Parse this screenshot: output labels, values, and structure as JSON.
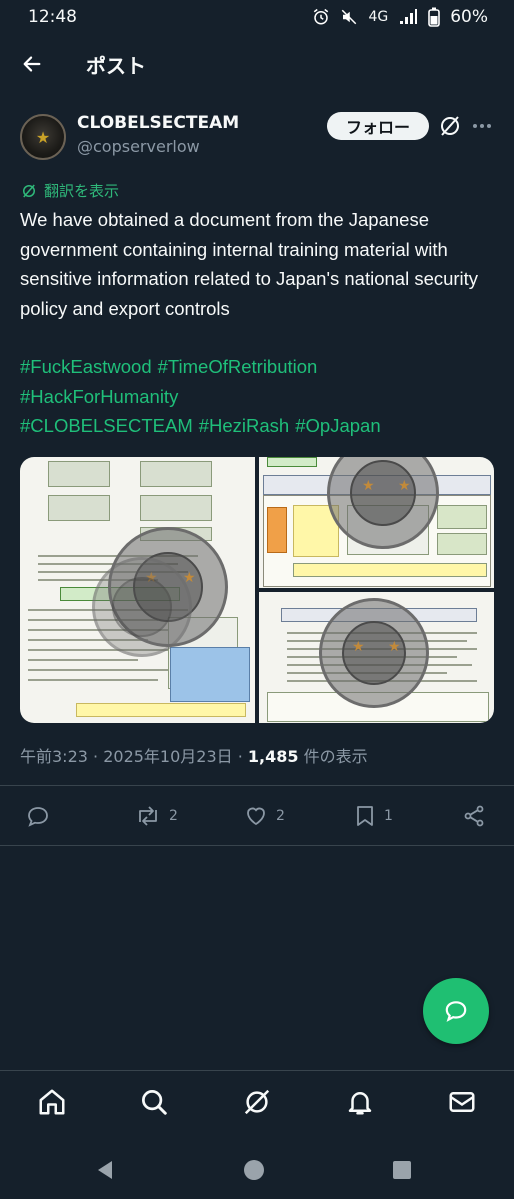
{
  "status_bar": {
    "time": "12:48",
    "network": "4G",
    "battery": "60%"
  },
  "header": {
    "back_icon": "arrow-left-icon",
    "title": "ポスト"
  },
  "author": {
    "name": "CLOBELSECTEAM",
    "handle": "@copserverlow",
    "follow_label": "フォロー"
  },
  "post": {
    "translate_label": "翻訳を表示",
    "text": "We have obtained a document from the Japanese government containing internal training material with sensitive information related to Japan's national security policy and export controls",
    "hashtags": [
      "#FuckEastwood",
      "#TimeOfRetribution",
      "#HackForHumanity",
      "#CLOBELSECTEAM",
      "#HeziRash",
      "#OpJapan"
    ]
  },
  "meta": {
    "time": "午前3:23",
    "date": "2025年10月23日",
    "views_count": "1,485",
    "views_label": "件の表示"
  },
  "actions": {
    "replies": "",
    "reposts": "2",
    "likes": "2",
    "bookmarks": "1"
  },
  "colors": {
    "background": "#15202b",
    "accent_green": "#1fbf72",
    "muted": "#8b98a5",
    "divider": "#38444d"
  }
}
